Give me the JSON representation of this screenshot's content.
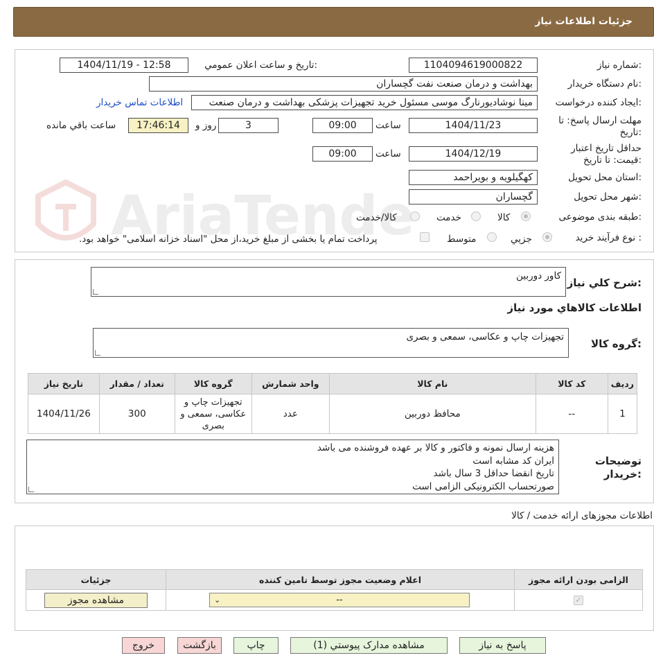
{
  "header": {
    "title": "جزئيات اطلاعات نياز"
  },
  "watermark": {
    "text": "AriaTender.neT"
  },
  "form": {
    "need_number": {
      "label": "شماره نياز:",
      "value": "1104094619000822"
    },
    "announce": {
      "label": "تاريخ و ساعت اعلان عمومي:",
      "value": "1404/11/19 - 12:58"
    },
    "buyer_org": {
      "label": "نام دستگاه خريدار:",
      "value": "بهداشت و درمان صنعت نفت گچساران"
    },
    "requester": {
      "label": "ايجاد کننده درخواست:",
      "value": "مینا نوشادیورنارگ موسی مسئول خرید تجهیزات پزشکی  بهداشت و درمان صنعت",
      "contact_link": "اطلاعات تماس خريدار"
    },
    "deadline": {
      "label": "مهلت ارسال پاسخ: تا تاريخ:",
      "date": "1404/11/23",
      "time_label": "ساعت",
      "time": "09:00",
      "days": "3",
      "days_label": "روز و",
      "remaining": "17:46:14",
      "remaining_label": "ساعت باقي مانده"
    },
    "validity": {
      "label": "حداقل تاريخ اعتبار قيمت: تا تاريخ:",
      "date": "1404/12/19",
      "time_label": "ساعت",
      "time": "09:00"
    },
    "province": {
      "label": "استان محل تحويل:",
      "value": "کهگیلویه و بویراحمد"
    },
    "city": {
      "label": "شهر محل تحويل:",
      "value": "گچساران"
    },
    "category": {
      "label": "طبقه بندی موضوعی:",
      "options": [
        "کالا",
        "خدمت",
        "کالا/خدمت"
      ]
    },
    "process": {
      "label": "نوع فرآيند خريد :",
      "options": [
        "جزيي",
        "متوسط"
      ],
      "note": "پرداخت تمام يا بخشی از مبلغ خريد،از محل \"اسناد خزانه اسلامی\" خواهد بود."
    }
  },
  "need": {
    "summary_label": "شرح کلي نياز:",
    "summary": "کاور دوربین",
    "goods_title": "اطلاعات کالاهاي مورد نياز",
    "group_label": "گروه کالا:",
    "group": "تجهیزات چاپ و عکاسی، سمعی و بصری",
    "table": {
      "headers": [
        "رديف",
        "کد کالا",
        "نام کالا",
        "واحد شمارش",
        "گروه کالا",
        "تعداد / مقدار",
        "تاريخ نياز"
      ],
      "rows": [
        [
          "1",
          "--",
          "محافظ دوربین",
          "عدد",
          "تجهیزات چاپ و عکاسی، سمعی و بصری",
          "300",
          "1404/11/26"
        ]
      ]
    },
    "buyer_notes_label": "توضيحات خريدار:",
    "buyer_notes": [
      "هزینه ارسال نمونه و فاکتور و کالا بر عهده فروشنده می باشد",
      "ایران کد مشابه است",
      "تاریخ انقضا حداقل 3 سال باشد",
      "صورتحساب الکترونیکی الزامی است"
    ]
  },
  "permits": {
    "title": "اطلاعات مجوزهای ارائه خدمت / کالا",
    "headers": [
      "الزامی بودن ارائه مجوز",
      "اعلام وضعيت مجوز توسط تامين کننده",
      "جزئيات"
    ],
    "select_value": "--",
    "view_button": "مشاهده مجوز"
  },
  "actions": {
    "reply": "پاسخ به نياز",
    "attachments": "مشاهده مدارک پيوستي (1)",
    "print": "چاپ",
    "back": "بازگشت",
    "exit": "خروج"
  },
  "colors": {
    "header": "#8a6a42",
    "link": "#1a4cc4",
    "pink_button": "#f8d6d6",
    "green_button": "#e6f5dc",
    "highlight": "#f7f1c4"
  }
}
